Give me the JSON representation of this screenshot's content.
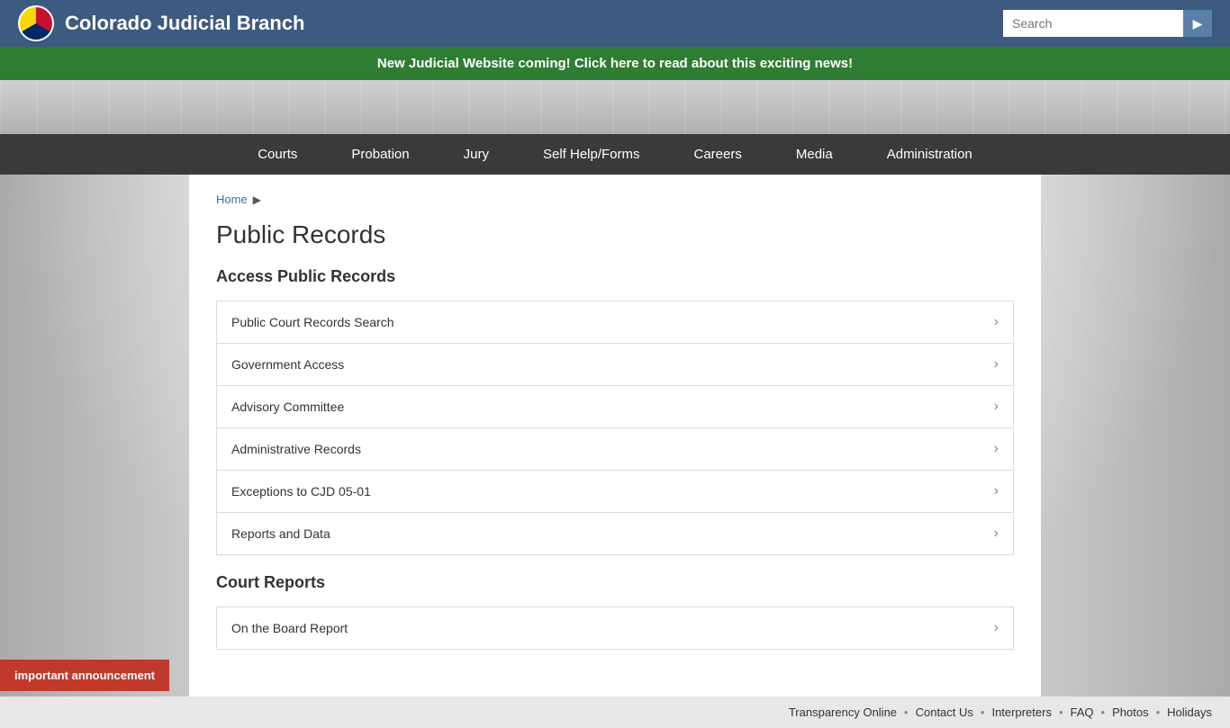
{
  "header": {
    "logo_alt": "Colorado Judicial Branch Seal",
    "site_title": "Colorado Judicial Branch",
    "search_placeholder": "Search",
    "search_btn_icon": "▶"
  },
  "announcement": {
    "text": "New Judicial Website coming! Click here to read about this exciting news!"
  },
  "nav": {
    "items": [
      {
        "label": "Courts",
        "id": "courts"
      },
      {
        "label": "Probation",
        "id": "probation"
      },
      {
        "label": "Jury",
        "id": "jury"
      },
      {
        "label": "Self Help/Forms",
        "id": "self-help"
      },
      {
        "label": "Careers",
        "id": "careers"
      },
      {
        "label": "Media",
        "id": "media"
      },
      {
        "label": "Administration",
        "id": "administration"
      }
    ]
  },
  "breadcrumb": {
    "home_label": "Home",
    "arrow": "▶"
  },
  "page": {
    "title": "Public Records",
    "access_heading": "Access Public Records",
    "records": [
      {
        "label": "Public Court Records Search",
        "id": "public-court-records"
      },
      {
        "label": "Government Access",
        "id": "government-access"
      },
      {
        "label": "Advisory Committee",
        "id": "advisory-committee"
      },
      {
        "label": "Administrative Records",
        "id": "administrative-records"
      },
      {
        "label": "Exceptions to CJD 05-01",
        "id": "exceptions-cjd"
      },
      {
        "label": "Reports and Data",
        "id": "reports-data"
      }
    ],
    "court_reports_heading": "Court Reports",
    "court_reports": [
      {
        "label": "On the Board Report",
        "id": "on-board-report"
      }
    ]
  },
  "footer": {
    "links": [
      {
        "label": "Transparency Online",
        "id": "transparency"
      },
      {
        "label": "Contact Us",
        "id": "contact-us"
      },
      {
        "label": "Interpreters",
        "id": "interpreters"
      },
      {
        "label": "FAQ",
        "id": "faq"
      },
      {
        "label": "Photos",
        "id": "photos"
      },
      {
        "label": "Holidays",
        "id": "holidays"
      }
    ],
    "separator": "•"
  },
  "important_announcement": {
    "label": "important announcement"
  }
}
